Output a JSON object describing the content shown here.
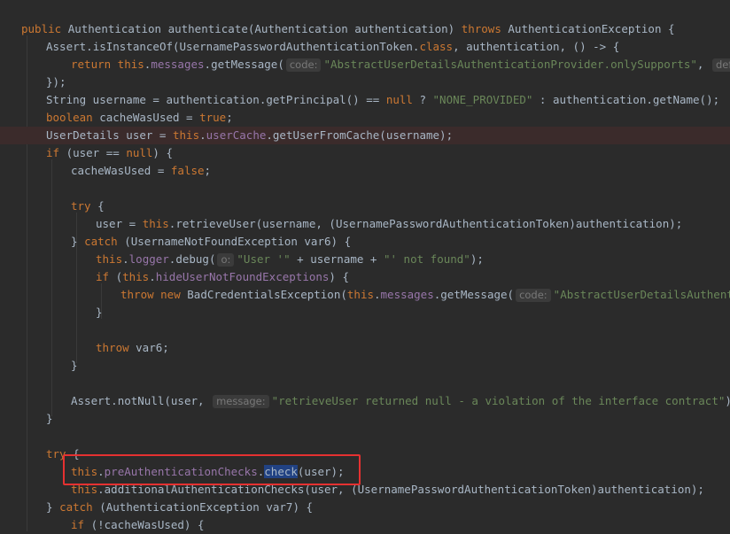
{
  "editor": {
    "lines": [
      {
        "indent": 24,
        "parts": [
          {
            "t": "public ",
            "c": "kw"
          },
          {
            "t": "Authentication authenticate(Authentication authentication) ",
            "c": "plain"
          },
          {
            "t": "throws ",
            "c": "kw"
          },
          {
            "t": "AuthenticationException {",
            "c": "plain"
          }
        ]
      },
      {
        "indent": 52,
        "parts": [
          {
            "t": "Assert.",
            "c": "plain"
          },
          {
            "t": "isInstanceOf",
            "c": "plain"
          },
          {
            "t": "(UsernamePasswordAuthenticationToken.",
            "c": "plain"
          },
          {
            "t": "class",
            "c": "kw"
          },
          {
            "t": ", authentication, () -> {",
            "c": "plain"
          }
        ]
      },
      {
        "indent": 80,
        "parts": [
          {
            "t": "return this",
            "c": "kw"
          },
          {
            "t": ".",
            "c": "plain"
          },
          {
            "t": "messages",
            "c": "fld"
          },
          {
            "t": ".getMessage(",
            "c": "plain"
          },
          {
            "t": "code:",
            "c": "hint"
          },
          {
            "t": "\"AbstractUserDetailsAuthenticationProvider.onlySupports\"",
            "c": "str"
          },
          {
            "t": ", ",
            "c": "plain"
          },
          {
            "t": "defaultMe",
            "c": "hint"
          }
        ]
      },
      {
        "indent": 52,
        "parts": [
          {
            "t": "});",
            "c": "plain"
          }
        ]
      },
      {
        "indent": 52,
        "parts": [
          {
            "t": "String username = authentication.getPrincipal() == ",
            "c": "plain"
          },
          {
            "t": "null ",
            "c": "kw"
          },
          {
            "t": "? ",
            "c": "plain"
          },
          {
            "t": "\"NONE_PROVIDED\"",
            "c": "str"
          },
          {
            "t": " : authentication.getName();",
            "c": "plain"
          }
        ]
      },
      {
        "indent": 52,
        "parts": [
          {
            "t": "boolean ",
            "c": "kw"
          },
          {
            "t": "cacheWasUsed = ",
            "c": "plain"
          },
          {
            "t": "true",
            "c": "kw"
          },
          {
            "t": ";",
            "c": "plain"
          }
        ]
      },
      {
        "indent": 52,
        "err": true,
        "parts": [
          {
            "t": "UserDetails user = ",
            "c": "plain"
          },
          {
            "t": "this",
            "c": "kw"
          },
          {
            "t": ".",
            "c": "plain"
          },
          {
            "t": "userCache",
            "c": "fld"
          },
          {
            "t": ".getUserFromCache(username);",
            "c": "plain"
          }
        ]
      },
      {
        "indent": 52,
        "parts": [
          {
            "t": "if ",
            "c": "kw"
          },
          {
            "t": "(user == ",
            "c": "plain"
          },
          {
            "t": "null",
            "c": "kw"
          },
          {
            "t": ") {",
            "c": "plain"
          }
        ]
      },
      {
        "indent": 80,
        "parts": [
          {
            "t": "cacheWasUsed = ",
            "c": "plain"
          },
          {
            "t": "false",
            "c": "kw"
          },
          {
            "t": ";",
            "c": "plain"
          }
        ]
      },
      {
        "indent": 80,
        "parts": []
      },
      {
        "indent": 80,
        "parts": [
          {
            "t": "try ",
            "c": "kw"
          },
          {
            "t": "{",
            "c": "plain"
          }
        ]
      },
      {
        "indent": 108,
        "parts": [
          {
            "t": "user = ",
            "c": "plain"
          },
          {
            "t": "this",
            "c": "kw"
          },
          {
            "t": ".retrieveUser(username, (UsernamePasswordAuthenticationToken)authentication);",
            "c": "plain"
          }
        ]
      },
      {
        "indent": 80,
        "parts": [
          {
            "t": "} ",
            "c": "plain"
          },
          {
            "t": "catch ",
            "c": "kw"
          },
          {
            "t": "(UsernameNotFoundException var6) {",
            "c": "plain"
          }
        ]
      },
      {
        "indent": 108,
        "parts": [
          {
            "t": "this",
            "c": "kw"
          },
          {
            "t": ".",
            "c": "plain"
          },
          {
            "t": "logger",
            "c": "fld"
          },
          {
            "t": ".debug(",
            "c": "plain"
          },
          {
            "t": "o:",
            "c": "hint"
          },
          {
            "t": "\"User '\"",
            "c": "str"
          },
          {
            "t": " + username + ",
            "c": "plain"
          },
          {
            "t": "\"' not found\"",
            "c": "str"
          },
          {
            "t": ");",
            "c": "plain"
          }
        ]
      },
      {
        "indent": 108,
        "parts": [
          {
            "t": "if ",
            "c": "kw"
          },
          {
            "t": "(",
            "c": "plain"
          },
          {
            "t": "this",
            "c": "kw"
          },
          {
            "t": ".",
            "c": "plain"
          },
          {
            "t": "hideUserNotFoundExceptions",
            "c": "fld"
          },
          {
            "t": ") {",
            "c": "plain"
          }
        ]
      },
      {
        "indent": 136,
        "parts": [
          {
            "t": "throw new ",
            "c": "kw"
          },
          {
            "t": "BadCredentialsException(",
            "c": "plain"
          },
          {
            "t": "this",
            "c": "kw"
          },
          {
            "t": ".",
            "c": "plain"
          },
          {
            "t": "messages",
            "c": "fld"
          },
          {
            "t": ".getMessage(",
            "c": "plain"
          },
          {
            "t": "code:",
            "c": "hint"
          },
          {
            "t": "\"AbstractUserDetailsAuthenticatio",
            "c": "str"
          }
        ]
      },
      {
        "indent": 108,
        "parts": [
          {
            "t": "}",
            "c": "plain"
          }
        ]
      },
      {
        "indent": 108,
        "parts": []
      },
      {
        "indent": 108,
        "parts": [
          {
            "t": "throw ",
            "c": "kw"
          },
          {
            "t": "var6;",
            "c": "plain"
          }
        ]
      },
      {
        "indent": 80,
        "parts": [
          {
            "t": "}",
            "c": "plain"
          }
        ]
      },
      {
        "indent": 80,
        "parts": []
      },
      {
        "indent": 80,
        "parts": [
          {
            "t": "Assert.",
            "c": "plain"
          },
          {
            "t": "notNull",
            "c": "plain"
          },
          {
            "t": "(user, ",
            "c": "plain"
          },
          {
            "t": "message:",
            "c": "hint"
          },
          {
            "t": "\"retrieveUser returned null - a violation of the interface contract\"",
            "c": "str"
          },
          {
            "t": ");",
            "c": "plain"
          }
        ]
      },
      {
        "indent": 52,
        "parts": [
          {
            "t": "}",
            "c": "plain"
          }
        ]
      },
      {
        "indent": 52,
        "parts": []
      },
      {
        "indent": 52,
        "parts": [
          {
            "t": "try ",
            "c": "kw"
          },
          {
            "t": "{",
            "c": "plain"
          }
        ]
      },
      {
        "indent": 80,
        "parts": [
          {
            "t": "this",
            "c": "kw"
          },
          {
            "t": ".",
            "c": "plain"
          },
          {
            "t": "preAuthenticationChecks",
            "c": "fld"
          },
          {
            "t": ".",
            "c": "plain"
          },
          {
            "t": "check",
            "c": "sel"
          },
          {
            "t": "(user);",
            "c": "plain"
          }
        ]
      },
      {
        "indent": 80,
        "parts": [
          {
            "t": "this",
            "c": "kw"
          },
          {
            "t": ".",
            "c": "plain"
          },
          {
            "t": "additionalAuthenticationChecks",
            "c": "plain"
          },
          {
            "t": "(user, (UsernamePasswordAuthenticationToken)authentication);",
            "c": "plain"
          }
        ]
      },
      {
        "indent": 52,
        "parts": [
          {
            "t": "} ",
            "c": "plain"
          },
          {
            "t": "catch ",
            "c": "kw"
          },
          {
            "t": "(AuthenticationException var7) {",
            "c": "plain"
          }
        ]
      },
      {
        "indent": 80,
        "parts": [
          {
            "t": "if ",
            "c": "kw"
          },
          {
            "t": "(!cacheWasUsed) {",
            "c": "plain"
          }
        ]
      }
    ]
  }
}
